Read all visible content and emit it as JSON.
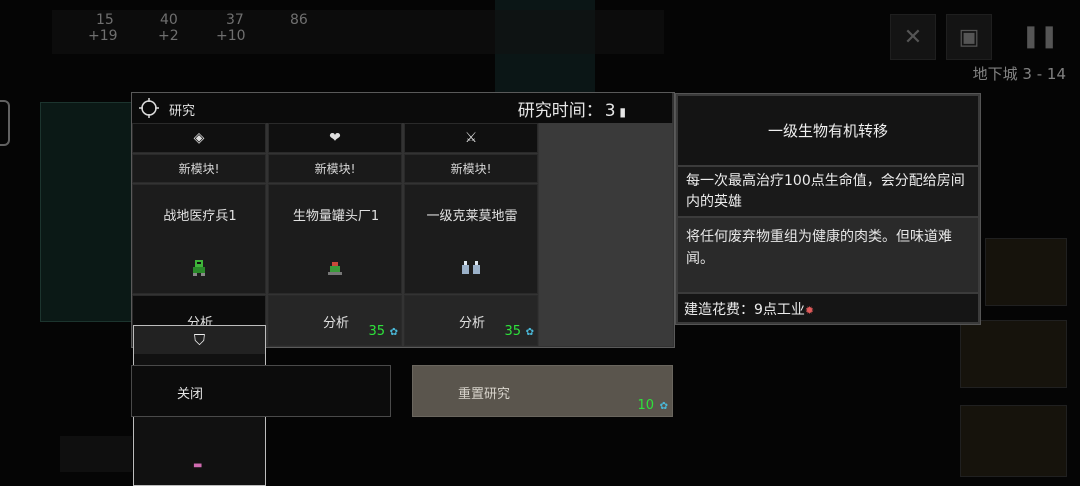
{
  "hud": {
    "resources": [
      {
        "icon": "industry-icon",
        "top": "15",
        "bottom": "+19"
      },
      {
        "icon": "science-icon",
        "top": "40",
        "bottom": "+2"
      },
      {
        "icon": "food-icon",
        "top": "37",
        "bottom": "+10"
      },
      {
        "icon": "dust-icon",
        "top": "86",
        "bottom": ""
      }
    ],
    "floor_label": "地下城 3 - 14"
  },
  "research_panel": {
    "title": "研究",
    "time_label": "研究时间：",
    "time_value": "3",
    "columns": [
      {
        "icon": "industry-diamond-icon",
        "icon_glyph": "◈",
        "badge": "新模块!",
        "name": "战地医疗兵1",
        "sprite": "medic-sprite-icon",
        "action": "分析",
        "cost": ""
      },
      {
        "icon": "heart-icon",
        "icon_glyph": "❤",
        "badge": "新模块!",
        "name": "生物量罐头厂1",
        "sprite": "cannery-sprite-icon",
        "action": "分析",
        "cost": "35"
      },
      {
        "icon": "sword-icon",
        "icon_glyph": "⚔",
        "badge": "新模块!",
        "name": "一级克莱莫地雷",
        "sprite": "claymore-sprite-icon",
        "action": "分析",
        "cost": "35"
      }
    ],
    "close_label": "关闭",
    "reset_label": "重置研究",
    "reset_cost": "10",
    "cost_currency_icon": "science-icon"
  },
  "info_panel": {
    "title": "一级生物有机转移",
    "description": "每一次最高治疗100点生命值，会分配给房间内的英雄",
    "flavor": "将任何废弃物重组为健康的肉类。但味道难闻。",
    "build_cost": "建造花费：9点工业",
    "build_cost_icon": "industry-icon"
  },
  "colors": {
    "cost_green": "#2ee23b",
    "science_blue": "#4ab8d8",
    "industry_red": "#e05a5a"
  }
}
